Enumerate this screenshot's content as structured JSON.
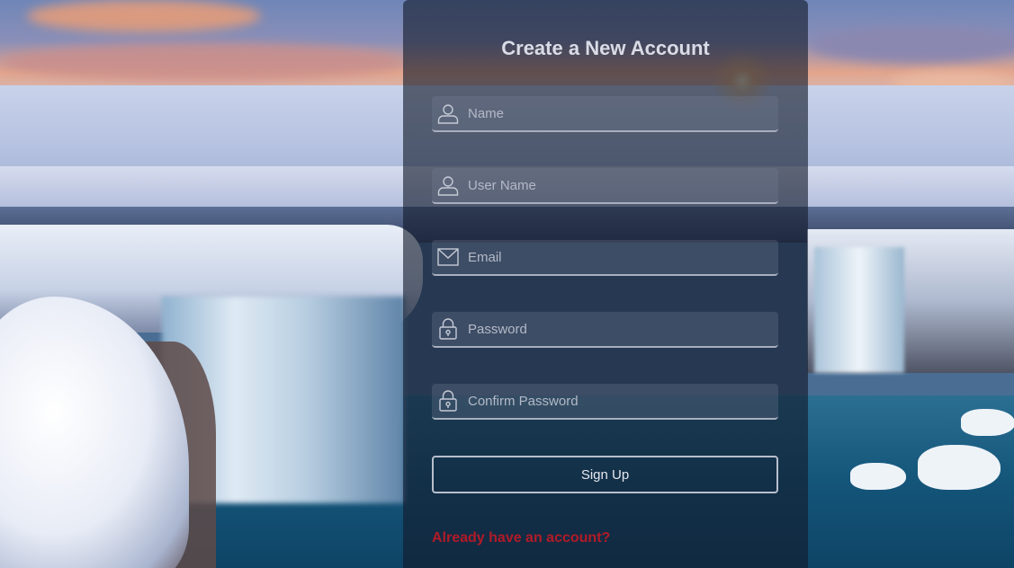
{
  "form": {
    "title": "Create a New Account",
    "fields": [
      {
        "placeholder": "Name",
        "value": "",
        "icon": "user-icon"
      },
      {
        "placeholder": "User Name",
        "value": "",
        "icon": "user-icon"
      },
      {
        "placeholder": "Email",
        "value": "",
        "icon": "envelope-icon"
      },
      {
        "placeholder": "Password",
        "value": "",
        "icon": "lock-icon"
      },
      {
        "placeholder": "Confirm Password",
        "value": "",
        "icon": "lock-icon"
      }
    ],
    "submit_label": "Sign Up",
    "login_link": "Already have an account?"
  },
  "colors": {
    "panel": "#111a2a",
    "text": "#d9dce6",
    "link": "#b31a28"
  }
}
